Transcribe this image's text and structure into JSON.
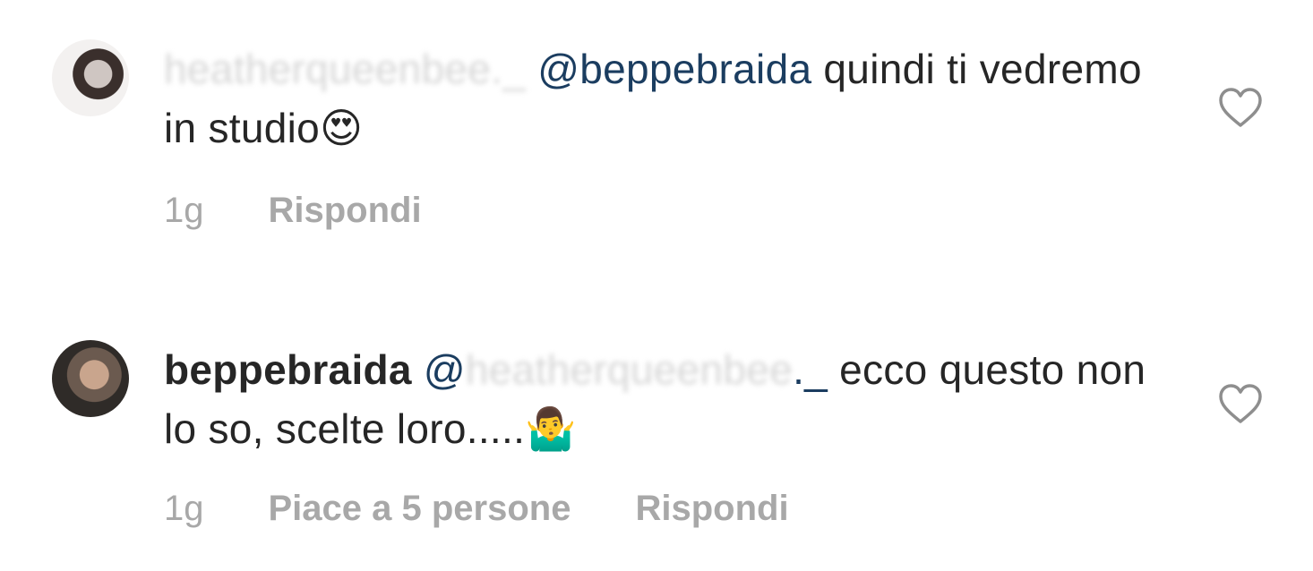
{
  "comments": [
    {
      "username": "heatherqueenbee._",
      "mention": "@beppebraida",
      "text_after_mention": " quindi ti vedremo in studio",
      "emoji": "😍",
      "time": "1g",
      "reply_label": "Rispondi"
    },
    {
      "username": "beppebraida",
      "mention_prefix": "@",
      "mention_blurred": "heatherqueenbee",
      "mention_tail": "._",
      "text_after_mention": " ecco questo non lo so, scelte loro.....",
      "emoji": "🤷‍♂️",
      "time": "1g",
      "likes_label": "Piace a 5 persone",
      "reply_label": "Rispondi"
    }
  ],
  "colors": {
    "mention": "#1b3d60",
    "meta": "#a8a8a8",
    "text": "#262626"
  },
  "icons": {
    "like": "heart-outline-icon"
  }
}
